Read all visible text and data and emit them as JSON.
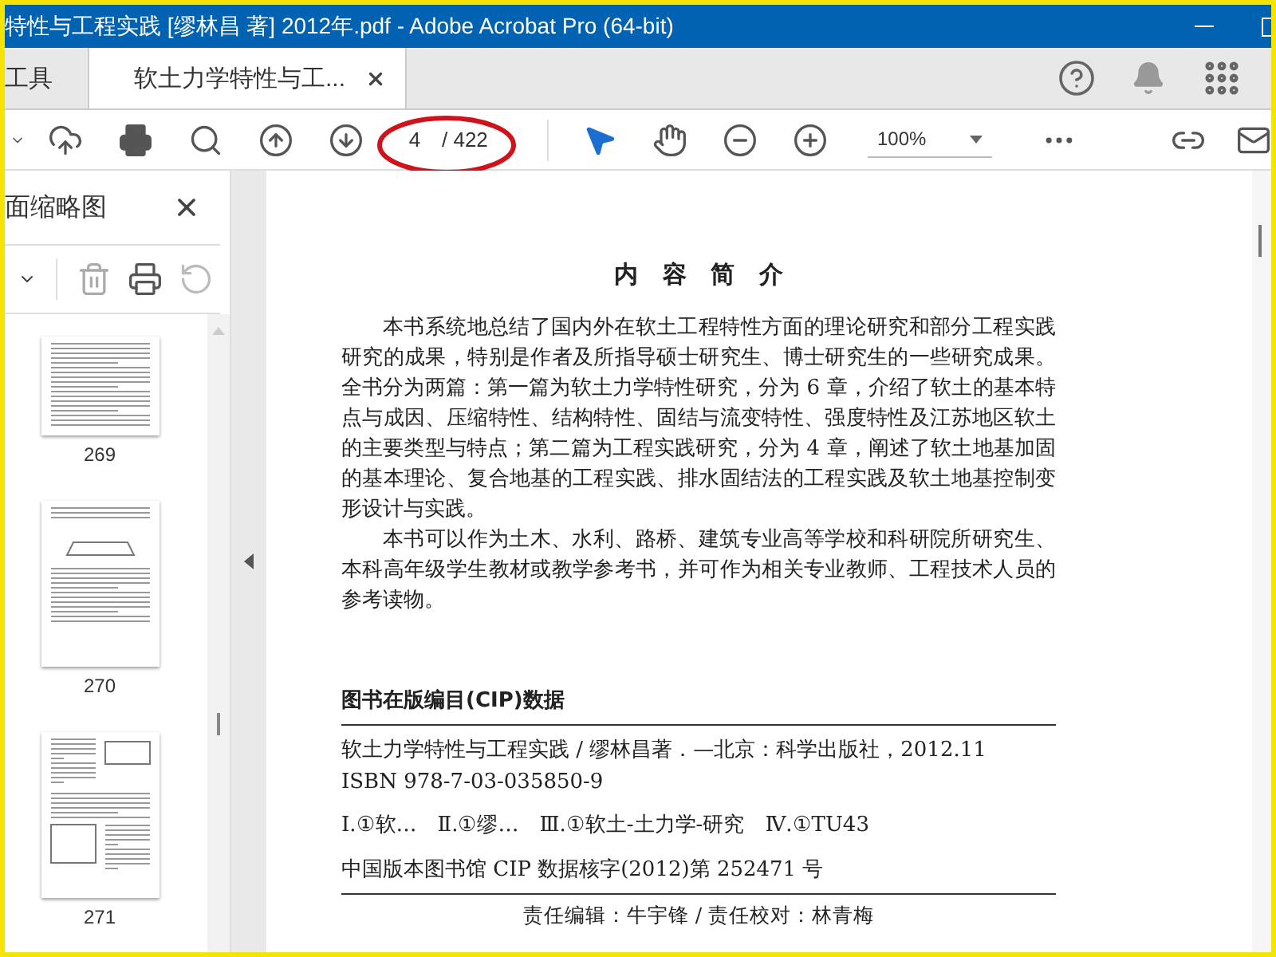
{
  "window": {
    "title": "特性与工程实践 [缪林昌 著] 2012年.pdf - Adobe Acrobat Pro (64-bit)"
  },
  "tabs": [
    {
      "label": "工具",
      "selected": false
    },
    {
      "label": "软土力学特性与工...",
      "selected": true
    }
  ],
  "toolbar": {
    "page_current": "4",
    "page_total": "/ 422",
    "zoom": "100%"
  },
  "sidebar": {
    "title": "面缩略图",
    "thumbnails": [
      {
        "label": "269",
        "kind": "text"
      },
      {
        "label": "270",
        "kind": "figure"
      },
      {
        "label": "271",
        "kind": "mixed"
      }
    ]
  },
  "document": {
    "heading": "内 容 简 介",
    "paragraphs": [
      "本书系统地总结了国内外在软土工程特性方面的理论研究和部分工程实践研究的成果，特别是作者及所指导硕士研究生、博士研究生的一些研究成果。全书分为两篇：第一篇为软土力学特性研究，分为 6 章，介绍了软土的基本特点与成因、压缩特性、结构特性、固结与流变特性、强度特性及江苏地区软土的主要类型与特点；第二篇为工程实践研究，分为 4 章，阐述了软土地基加固的基本理论、复合地基的工程实践、排水固结法的工程实践及软土地基控制变形设计与实践。",
      "本书可以作为土木、水利、路桥、建筑专业高等学校和科研院所研究生、本科高年级学生教材或教学参考书，并可作为相关专业教师、工程技术人员的参考读物。"
    ],
    "cip_heading": "图书在版编目(CIP)数据",
    "cip_lines": [
      "软土力学特性与工程实践 / 缪林昌著．—北京：科学出版社，2012.11",
      "ISBN 978-7-03-035850-9",
      "Ⅰ.①软…　Ⅱ.①缪…　Ⅲ.①软土-土力学-研究　Ⅳ.①TU43",
      "中国版本图书馆 CIP 数据核字(2012)第 252471 号"
    ],
    "credits": "责任编辑：牛宇锋 / 责任校对：林青梅"
  }
}
